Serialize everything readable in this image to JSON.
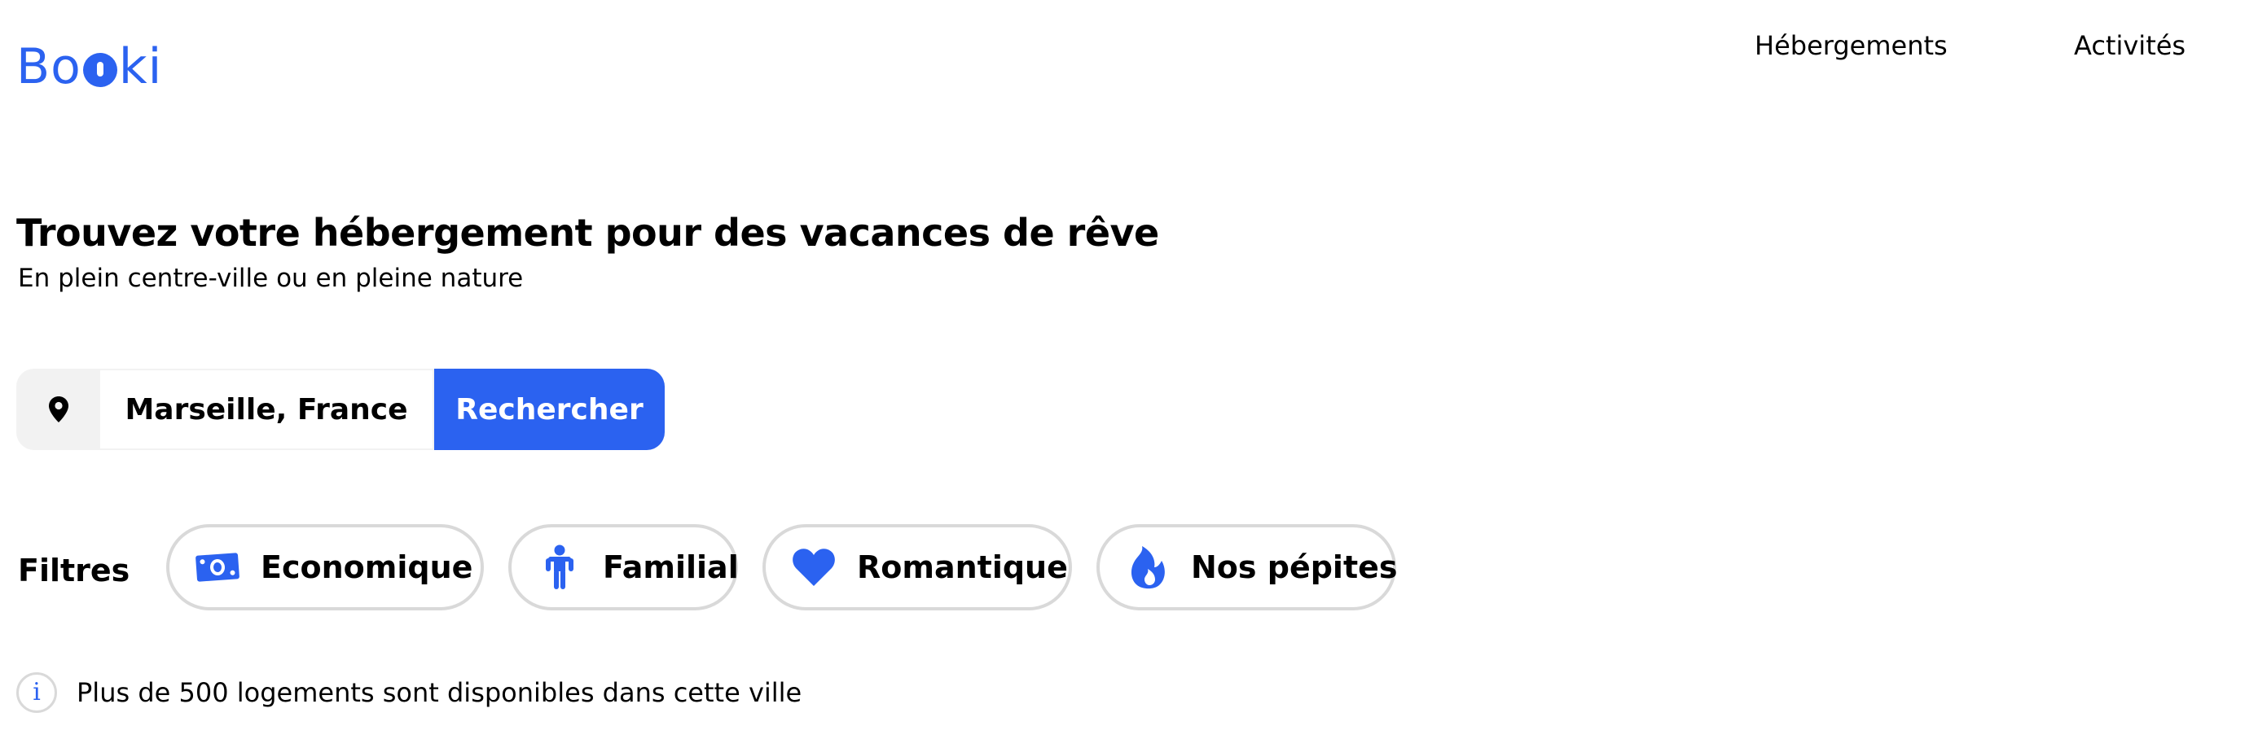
{
  "brand": {
    "logo_text_start": "B",
    "logo_text_middle": "o",
    "logo_text_end": "ki",
    "logo_full": "Booki",
    "color": "#2b62f0"
  },
  "nav": {
    "items": [
      {
        "label": "Hébergements"
      },
      {
        "label": "Activités"
      }
    ]
  },
  "hero": {
    "title": "Trouvez votre hébergement pour des vacances de rêve",
    "subtitle": "En plein centre-ville ou en pleine nature"
  },
  "search": {
    "location_icon": "map-pin-icon",
    "value": "Marseille, France",
    "button_label": "Rechercher"
  },
  "filters": {
    "label": "Filtres",
    "items": [
      {
        "label": "Economique",
        "icon": "money-bill-icon"
      },
      {
        "label": "Familial",
        "icon": "child-icon"
      },
      {
        "label": "Romantique",
        "icon": "heart-icon"
      },
      {
        "label": "Nos pépites",
        "icon": "fire-icon"
      }
    ]
  },
  "info": {
    "icon": "info-icon",
    "icon_glyph": "i",
    "text": "Plus de 500 logements sont disponibles dans cette ville"
  },
  "colors": {
    "accent": "#2b62f0",
    "chip_border": "#d9d9d9",
    "search_icon_bg": "#f2f2f2",
    "text": "#000000"
  }
}
